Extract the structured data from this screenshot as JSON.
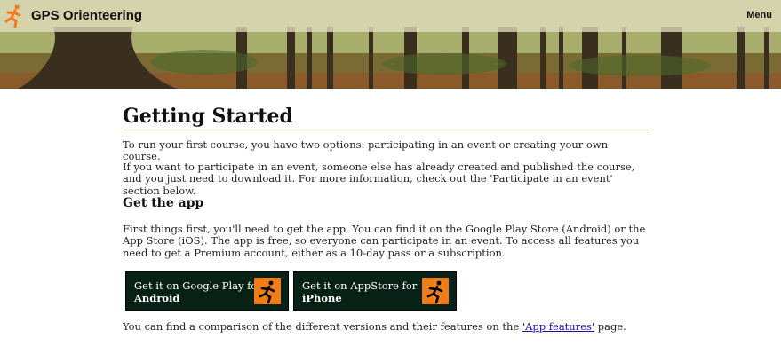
{
  "header": {
    "app_title": "GPS Orienteering",
    "menu_label": "Menu"
  },
  "main": {
    "title": "Getting Started",
    "intro": "To run your first course, you have two options: participating in an event or creating your own course.",
    "participate_text": "If you want to participate in an event, someone else has already created and published the course, and you just need to download it. For more information, check out the 'Participate in an event' section below.",
    "get_app_heading": "Get the app",
    "get_app_text": "First things first, you'll need to get the app. You can find it on the Google Play Store (Android) or the App Store (iOS). The app is free, so everyone can participate in an event. To access all features you need to get a Premium account, either as a 10-day pass or a subscription.",
    "buttons": {
      "android_line1": "Get it on Google Play for",
      "android_line2": "Android",
      "ios_line1": "Get it on AppStore for",
      "ios_line2": "iPhone"
    },
    "comparison_prefix": "You can find a comparison of the different versions and their features on the ",
    "comparison_link": "'App features'",
    "comparison_suffix": " page."
  },
  "colors": {
    "accent_orange": "#ef7d1a",
    "button_bg": "#082117",
    "heading_rule": "#a9b36c"
  },
  "icons": [
    "runner-logo-icon",
    "runner-icon"
  ]
}
